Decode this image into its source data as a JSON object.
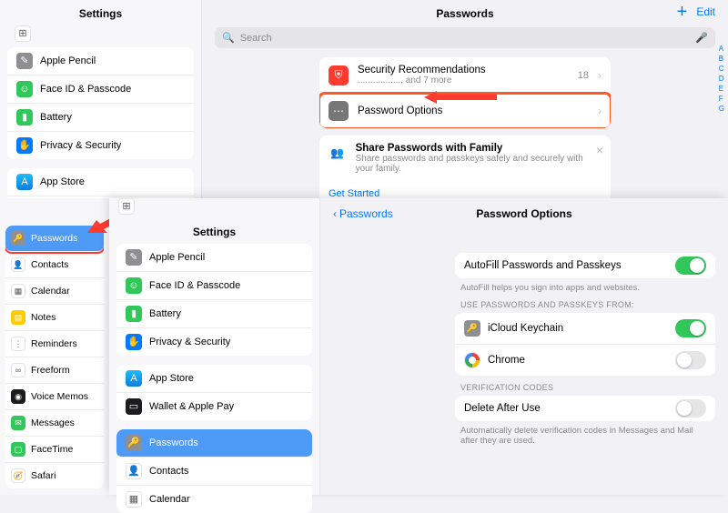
{
  "layer1": {
    "sidebar_title": "Settings",
    "group_a": [
      {
        "icon": "✎",
        "cls": "gray",
        "name": "apple-pencil",
        "label": "Apple Pencil"
      },
      {
        "icon": "☺",
        "cls": "green",
        "name": "faceid",
        "label": "Face ID & Passcode"
      },
      {
        "icon": "▮",
        "cls": "green",
        "name": "battery",
        "label": "Battery"
      },
      {
        "icon": "✋",
        "cls": "blue-i",
        "name": "privacy",
        "label": "Privacy & Security"
      }
    ],
    "group_b": [
      {
        "icon": "A",
        "cls": "appstore",
        "name": "appstore",
        "label": "App Store"
      },
      {
        "icon": "▭",
        "cls": "black-i",
        "name": "wallet",
        "label": "Wallet & Apple Pay"
      }
    ],
    "main_title": "Passwords",
    "edit": "Edit",
    "search_placeholder": "Search",
    "rec": {
      "title": "Security Recommendations",
      "sub": "................., and 7 more",
      "count": "18"
    },
    "options": {
      "title": "Password Options"
    },
    "share": {
      "title": "Share Passwords with Family",
      "sub": "Share passwords and passkeys safely and securely with your family.",
      "cta": "Get Started"
    },
    "alpha": [
      "A",
      "B",
      "C",
      "D",
      "E",
      "F",
      "G"
    ]
  },
  "left_ext": {
    "group_c": [
      {
        "icon": "🔑",
        "cls": "gray",
        "name": "passwords",
        "label": "Passwords",
        "selected": 1
      },
      {
        "icon": "👤",
        "cls": "white-i",
        "name": "contacts",
        "label": "Contacts"
      },
      {
        "icon": "▦",
        "cls": "white-i",
        "name": "calendar",
        "label": "Calendar"
      },
      {
        "icon": "▤",
        "cls": "yellow-i",
        "name": "notes",
        "label": "Notes"
      },
      {
        "icon": "⋮",
        "cls": "white-i",
        "name": "reminders",
        "label": "Reminders"
      },
      {
        "icon": "∞",
        "cls": "white-i",
        "name": "freeform",
        "label": "Freeform"
      },
      {
        "icon": "◉",
        "cls": "black-i",
        "name": "voicememos",
        "label": "Voice Memos"
      },
      {
        "icon": "✉",
        "cls": "green",
        "name": "messages",
        "label": "Messages"
      },
      {
        "icon": "▢",
        "cls": "green",
        "name": "facetime",
        "label": "FaceTime"
      },
      {
        "icon": "🧭",
        "cls": "white-i",
        "name": "safari",
        "label": "Safari"
      }
    ]
  },
  "layer2": {
    "sidebar_title": "Settings",
    "group_a": [
      {
        "icon": "✎",
        "cls": "gray",
        "name": "apple-pencil",
        "label": "Apple Pencil"
      },
      {
        "icon": "☺",
        "cls": "green",
        "name": "faceid",
        "label": "Face ID & Passcode"
      },
      {
        "icon": "▮",
        "cls": "green",
        "name": "battery",
        "label": "Battery"
      },
      {
        "icon": "✋",
        "cls": "blue-i",
        "name": "privacy",
        "label": "Privacy & Security"
      }
    ],
    "group_b": [
      {
        "icon": "A",
        "cls": "appstore",
        "name": "appstore",
        "label": "App Store"
      },
      {
        "icon": "▭",
        "cls": "black-i",
        "name": "wallet",
        "label": "Wallet & Apple Pay"
      }
    ],
    "group_c": [
      {
        "icon": "🔑",
        "cls": "gray",
        "name": "passwords",
        "label": "Passwords",
        "selected": 1
      },
      {
        "icon": "👤",
        "cls": "white-i",
        "name": "contacts",
        "label": "Contacts"
      },
      {
        "icon": "▦",
        "cls": "white-i",
        "name": "calendar",
        "label": "Calendar"
      }
    ],
    "back": "Passwords",
    "title": "Password Options",
    "autofill": {
      "label": "AutoFill Passwords and Passkeys",
      "foot": "AutoFill helps you sign into apps and websites."
    },
    "use_caption": "USE PASSWORDS AND PASSKEYS FROM:",
    "sources": [
      {
        "label": "iCloud Keychain",
        "icon": "🔑",
        "on": 1,
        "bg": "gray"
      },
      {
        "label": "Chrome",
        "icon": "◉",
        "on": 0,
        "bg": "white-i"
      }
    ],
    "verif_caption": "VERIFICATION CODES",
    "delete": {
      "label": "Delete After Use",
      "foot": "Automatically delete verification codes in Messages and Mail after they are used."
    }
  }
}
